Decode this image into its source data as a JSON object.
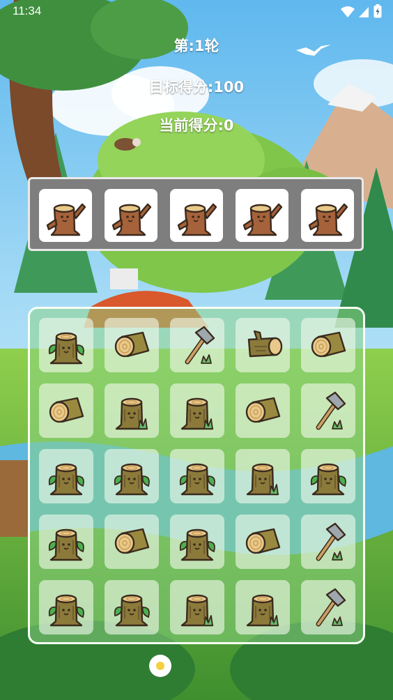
{
  "status_bar": {
    "time": "11:34",
    "icons": [
      "wifi-icon",
      "signal-icon",
      "battery-icon"
    ]
  },
  "hud": {
    "round": "第:1轮",
    "target_score": "目标得分:100",
    "current_score": "当前得分:0"
  },
  "slot_bar": {
    "slots": [
      "waving-stump",
      "waving-stump",
      "waving-stump",
      "waving-stump",
      "waving-stump"
    ]
  },
  "board": {
    "rows": [
      [
        "leafy-stump",
        "round-log",
        "axe",
        "branch-log",
        "round-log"
      ],
      [
        "round-log",
        "grass-stump",
        "grass-stump",
        "round-log",
        "axe"
      ],
      [
        "leafy-stump",
        "leafy-stump",
        "leafy-stump",
        "grass-stump",
        "leafy-stump"
      ],
      [
        "leafy-stump",
        "round-log",
        "leafy-stump",
        "round-log",
        "axe"
      ],
      [
        "leafy-stump",
        "leafy-stump",
        "grass-stump",
        "grass-stump",
        "axe"
      ]
    ]
  },
  "colors": {
    "wood": "#a6623a",
    "wood_dark": "#3a2a1e",
    "log_end": "#e8c98a",
    "leaf": "#4caf50",
    "grass": "#66bb6a",
    "board_tint": "#8cd282",
    "slot_bar": "#7e7e7e"
  }
}
